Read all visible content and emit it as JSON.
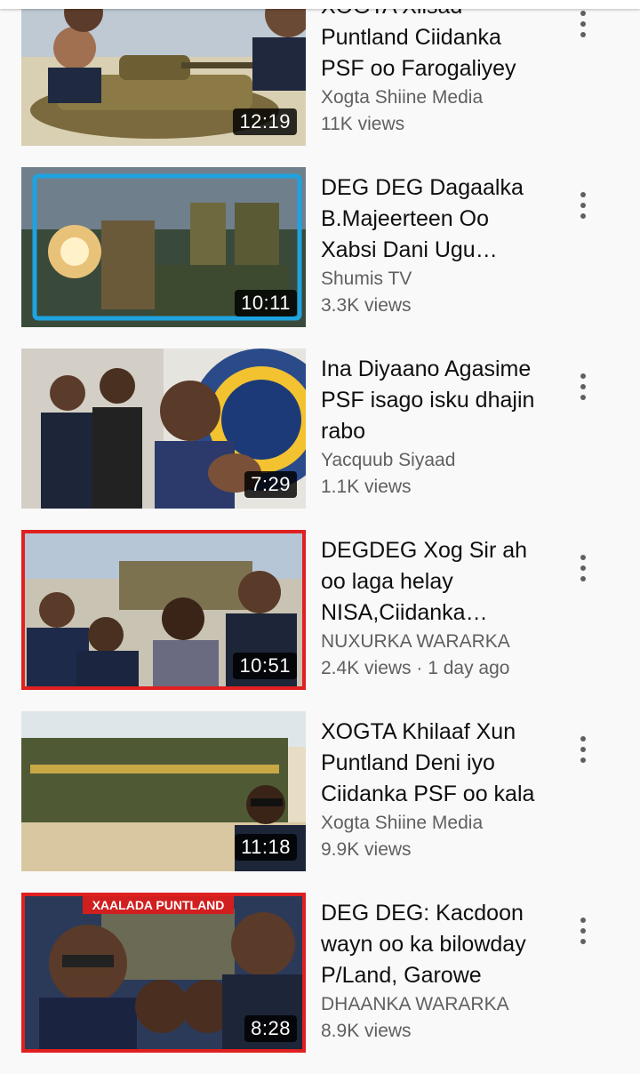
{
  "videos": [
    {
      "title": "XOGTA Xiisad Puntland Ciidanka PSF oo Farogaliyey",
      "channel": "Xogta Shiine Media",
      "views": "11K views",
      "duration": "12:19"
    },
    {
      "title": "DEG DEG Dagaalka B.Majeerteen Oo Xabsi Dani Ugu Dhowaaday",
      "channel": "Shumis TV",
      "views": "3.3K views",
      "duration": "10:11"
    },
    {
      "title": "Ina Diyaano Agasime PSF isago isku dhajin rabo",
      "channel": "Yacquub Siyaad",
      "views": "1.1K views",
      "duration": "7:29"
    },
    {
      "title": "DEGDEG Xog Sir ah oo laga helay NISA,Ciidanka Puntland",
      "channel": "NUXURKA WARARKA",
      "views": "2.4K views · 1 day ago",
      "duration": "10:51"
    },
    {
      "title": "XOGTA Khilaaf Xun Puntland Deni iyo Ciidanka PSF oo kala",
      "channel": "Xogta Shiine Media",
      "views": "9.9K views",
      "duration": "11:18"
    },
    {
      "title": "DEG DEG: Kacdoon wayn oo ka bilowday P/Land, Garowe",
      "channel": "DHAANKA WARARKA",
      "views": "8.9K views",
      "duration": "8:28",
      "banner": "XAALADA PUNTLAND"
    }
  ]
}
